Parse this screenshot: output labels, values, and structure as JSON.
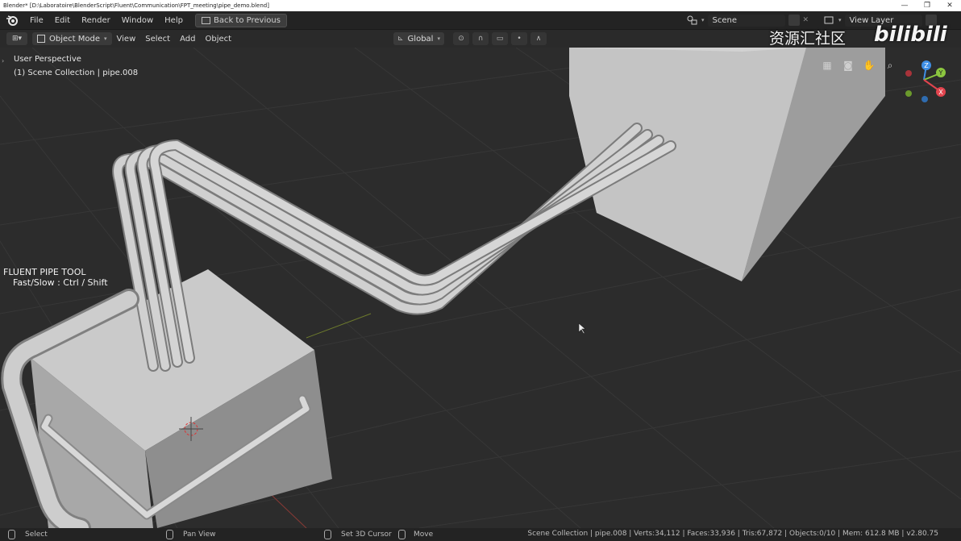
{
  "window": {
    "title": "Blender* [D:\\Laboratoire\\BlenderScript\\Fluent\\Communication\\FPT_meeting\\pipe_demo.blend]",
    "controls": [
      "—",
      "❐",
      "✕"
    ]
  },
  "menubar": {
    "items": [
      "File",
      "Edit",
      "Render",
      "Window",
      "Help"
    ],
    "back_label": "Back to Previous",
    "scene_label": "Scene",
    "view_layer_label": "View Layer"
  },
  "viewport_header": {
    "mode_label": "Object Mode",
    "menu_items": [
      "View",
      "Select",
      "Add",
      "Object"
    ],
    "orientation_label": "Global"
  },
  "viewport": {
    "perspective_label": "User Perspective",
    "collection_label": "(1) Scene Collection | pipe.008",
    "tool_title": "FLUENT PIPE TOOL",
    "tool_hint": "Fast/Slow : Ctrl / Shift",
    "gizmo_axes": [
      "Z",
      "Y",
      "X"
    ]
  },
  "watermark": {
    "text": "资源汇社区",
    "brand": "bilibili"
  },
  "statusbar": {
    "select_label": "Select",
    "pan_label": "Pan View",
    "cursor_label": "Set 3D Cursor",
    "move_label": "Move",
    "info": "Scene Collection | pipe.008 | Verts:34,112 | Faces:33,936 | Tris:67,872 | Objects:0/10 | Mem: 612.8 MB | v2.80.75"
  },
  "colors": {
    "gizmo_x": "#e2444e",
    "gizmo_y": "#8bc63f",
    "gizmo_z": "#3f8fe6",
    "grid": "#3a3a3a",
    "cube": "#bdbdbd"
  }
}
